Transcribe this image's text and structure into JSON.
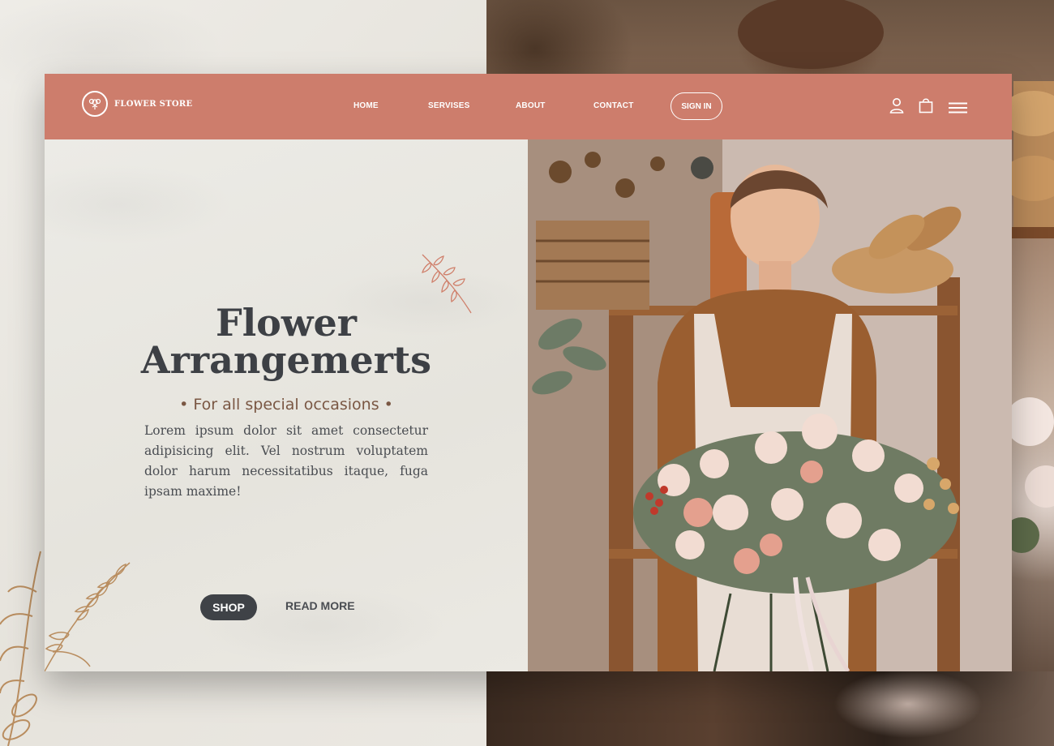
{
  "brand": {
    "name": "FLOWER STORE"
  },
  "nav": {
    "links": [
      "HOME",
      "SERVISES",
      "ABOUT",
      "CONTACT"
    ],
    "sign_in": "SIGN IN"
  },
  "hero": {
    "title": "Flower\nArrangemerts",
    "subtitle": "• For all special occasions •",
    "body": "Lorem ipsum dolor sit amet consectetur adipisicing elit. Vel nostrum voluptatem dolor harum necessitatibus itaque, fuga ipsam maxime!",
    "shop_label": "SHOP",
    "read_more_label": "READ MORE"
  },
  "icons": [
    "user-icon",
    "shopping-bag-icon",
    "hamburger-menu-icon",
    "flower-logo-icon"
  ],
  "colors": {
    "nav_bg": "#cd7d6c",
    "title": "#3d4045",
    "subtitle": "#7a5743",
    "button_bg": "#3f4247",
    "accent_line": "#c8775f"
  }
}
